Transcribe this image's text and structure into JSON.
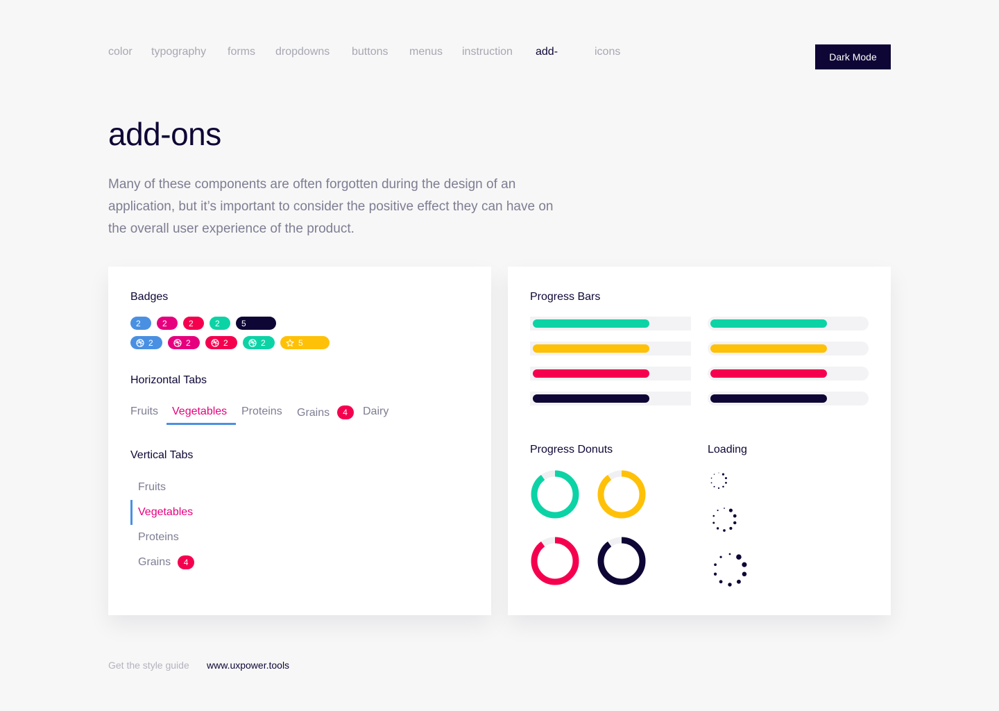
{
  "nav": {
    "items": [
      "color",
      "typography",
      "forms",
      "dropdowns",
      "buttons",
      "menus",
      "instruction",
      "add-",
      "icons"
    ],
    "active_index": 7,
    "dark_mode_label": "Dark Mode"
  },
  "page": {
    "title": "add-ons",
    "intro": "Many of these components are often forgotten during the design of an application, but it’s important to consider the positive effect they can have on the overall user experience of the product."
  },
  "badges": {
    "title": "Badges",
    "row1": [
      {
        "value": "2",
        "color": "#4a90e2"
      },
      {
        "value": "2",
        "color": "#e6007e"
      },
      {
        "value": "2",
        "color": "#f5004f"
      },
      {
        "value": "2",
        "color": "#0cd3a6"
      },
      {
        "value": "5",
        "color": "#0e0635"
      }
    ],
    "row2": [
      {
        "value": "2",
        "icon": "dribbble-icon",
        "color": "#4a90e2"
      },
      {
        "value": "2",
        "icon": "dribbble-icon",
        "color": "#e6007e"
      },
      {
        "value": "2",
        "icon": "dribbble-icon",
        "color": "#f5004f"
      },
      {
        "value": "2",
        "icon": "dribbble-icon",
        "color": "#0cd3a6"
      },
      {
        "value": "5",
        "icon": "star-icon",
        "color": "#ffc107"
      }
    ]
  },
  "horizontal_tabs": {
    "title": "Horizontal Tabs",
    "items": [
      {
        "label": "Fruits"
      },
      {
        "label": "Vegetables",
        "active": true
      },
      {
        "label": "Proteins"
      },
      {
        "label": "Grains",
        "count": "4"
      },
      {
        "label": "Dairy"
      }
    ]
  },
  "vertical_tabs": {
    "title": "Vertical Tabs",
    "items": [
      {
        "label": "Fruits"
      },
      {
        "label": "Vegetables",
        "active": true
      },
      {
        "label": "Proteins"
      },
      {
        "label": "Grains",
        "count": "4"
      }
    ]
  },
  "progress_bars": {
    "title": "Progress Bars",
    "bars": [
      {
        "color": "#0cd3a6",
        "value": 0.75
      },
      {
        "color": "#ffc107",
        "value": 0.75
      },
      {
        "color": "#f5004f",
        "value": 0.75
      },
      {
        "color": "#0e0635",
        "value": 0.75
      }
    ]
  },
  "progress_donuts": {
    "title": "Progress Donuts",
    "donuts": [
      {
        "color": "#0cd3a6",
        "value": 0.9
      },
      {
        "color": "#ffc107",
        "value": 0.9
      },
      {
        "color": "#f5004f",
        "value": 0.9
      },
      {
        "color": "#0e0635",
        "value": 0.9
      }
    ]
  },
  "loading": {
    "title": "Loading",
    "color": "#0e0635"
  },
  "footer": {
    "label": "Get the style guide",
    "link": "www.uxpower.tools"
  },
  "colors": {
    "navy": "#0e0635",
    "blue": "#4a90e2",
    "pink": "#e6007e",
    "red": "#f5004f",
    "teal": "#0cd3a6",
    "yellow": "#ffc107"
  }
}
